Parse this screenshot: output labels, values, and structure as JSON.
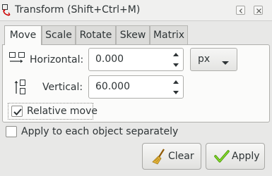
{
  "window": {
    "title": "Transform (Shift+Ctrl+M)",
    "icon": "transform-icon",
    "controls": [
      "restore-icon",
      "close-icon"
    ]
  },
  "tabs": [
    {
      "label": "Move",
      "active": true
    },
    {
      "label": "Scale",
      "active": false
    },
    {
      "label": "Rotate",
      "active": false
    },
    {
      "label": "Skew",
      "active": false
    },
    {
      "label": "Matrix",
      "active": false
    }
  ],
  "move": {
    "horizontal": {
      "label": "Horizontal:",
      "value": "0.000",
      "icon": "horizontal-move-icon"
    },
    "vertical": {
      "label": "Vertical:",
      "value": "60.000",
      "icon": "vertical-move-icon"
    },
    "unit": {
      "selected": "px"
    },
    "relative_move": {
      "label": "Relative move",
      "checked": true
    }
  },
  "apply_separately": {
    "label": "Apply to each object separately",
    "checked": false
  },
  "buttons": {
    "clear": {
      "label": "Clear",
      "icon": "broom-icon"
    },
    "apply": {
      "label": "Apply",
      "icon": "checkmark-icon"
    }
  },
  "colors": {
    "accent_green": "#4e9a06",
    "broom_yellow": "#e5b53b",
    "title_icon_red": "#cc0000"
  }
}
